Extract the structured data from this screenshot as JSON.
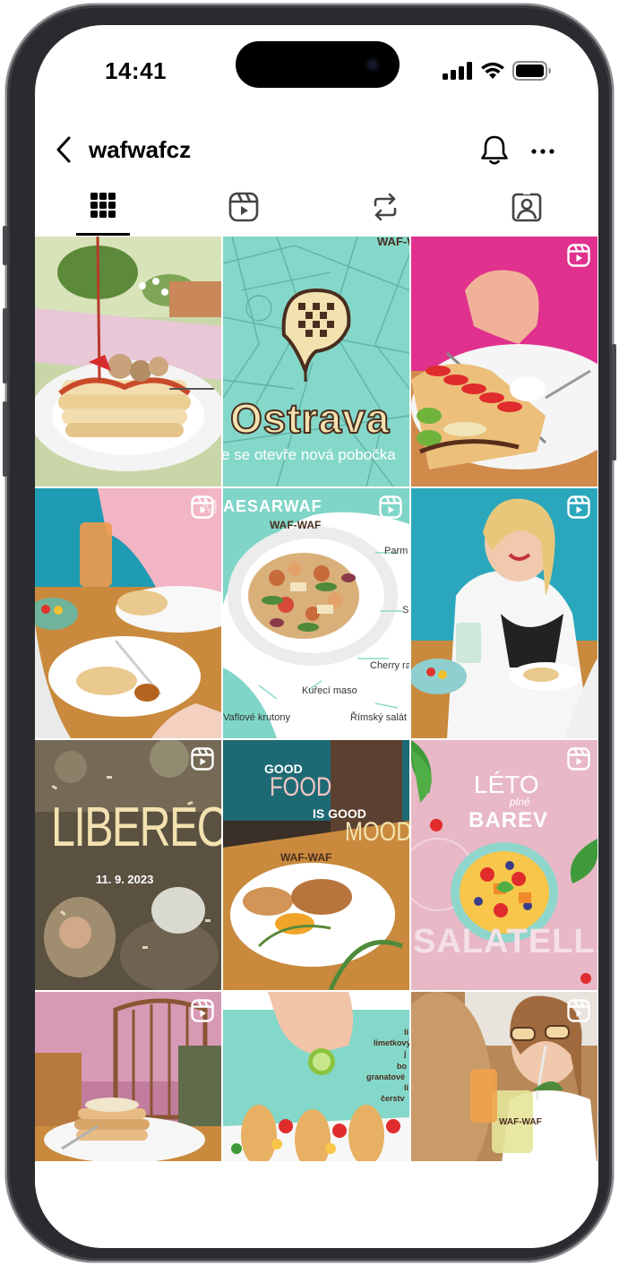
{
  "status_bar": {
    "time": "14:41"
  },
  "header": {
    "username": "wafwafcz"
  },
  "tabs": [
    {
      "name": "posts-grid",
      "active": true
    },
    {
      "name": "reels",
      "active": false
    },
    {
      "name": "reposts",
      "active": false
    },
    {
      "name": "tagged",
      "active": false
    }
  ],
  "grid": [
    {
      "type": "photo",
      "reel": false
    },
    {
      "type": "graphic",
      "reel": false,
      "texts": {
        "logo": "WAF-WAF",
        "city": "Ostrava",
        "caption": "e se otevře nová pobočka"
      }
    },
    {
      "type": "photo",
      "reel": true
    },
    {
      "type": "photo",
      "reel": true,
      "texts": {
        "corner": "M"
      }
    },
    {
      "type": "graphic",
      "reel": true,
      "texts": {
        "title": "AESARWAF",
        "logo": "WAF-WAF",
        "l1": "Parm",
        "l2": "S",
        "l3": "Cherry ra",
        "l4": "Kuřecí maso",
        "l5": "Vaflové krutony",
        "l6": "Římský salát"
      }
    },
    {
      "type": "photo",
      "reel": true
    },
    {
      "type": "graphic",
      "reel": true,
      "texts": {
        "city": "LIBEREC",
        "date": "11. 9. 2023"
      }
    },
    {
      "type": "graphic",
      "reel": false,
      "texts": {
        "good": "GOOD",
        "food": "FOOD",
        "isgood": "IS GOOD",
        "mood": "MOOD",
        "logo": "WAF-WAF"
      }
    },
    {
      "type": "graphic",
      "reel": true,
      "texts": {
        "leto": "LÉTO",
        "plne": "plné",
        "barev": "BAREV",
        "salatella": "SALATELLA"
      }
    },
    {
      "type": "photo",
      "reel": true
    },
    {
      "type": "graphic",
      "reel": false,
      "texts": {
        "r1": "li",
        "r2": "limetkový",
        "r3": "j",
        "r4": "bo",
        "r5": "granatové",
        "r6": "li",
        "r7": "čerstv"
      }
    },
    {
      "type": "photo",
      "reel": true,
      "texts": {
        "logo": "WAF-WAF"
      }
    }
  ],
  "colors": {
    "mint": "#7fd5c7",
    "pink": "#e7b9c6",
    "brand_dark": "#4a2d1e",
    "cream": "#f3e2b0"
  }
}
